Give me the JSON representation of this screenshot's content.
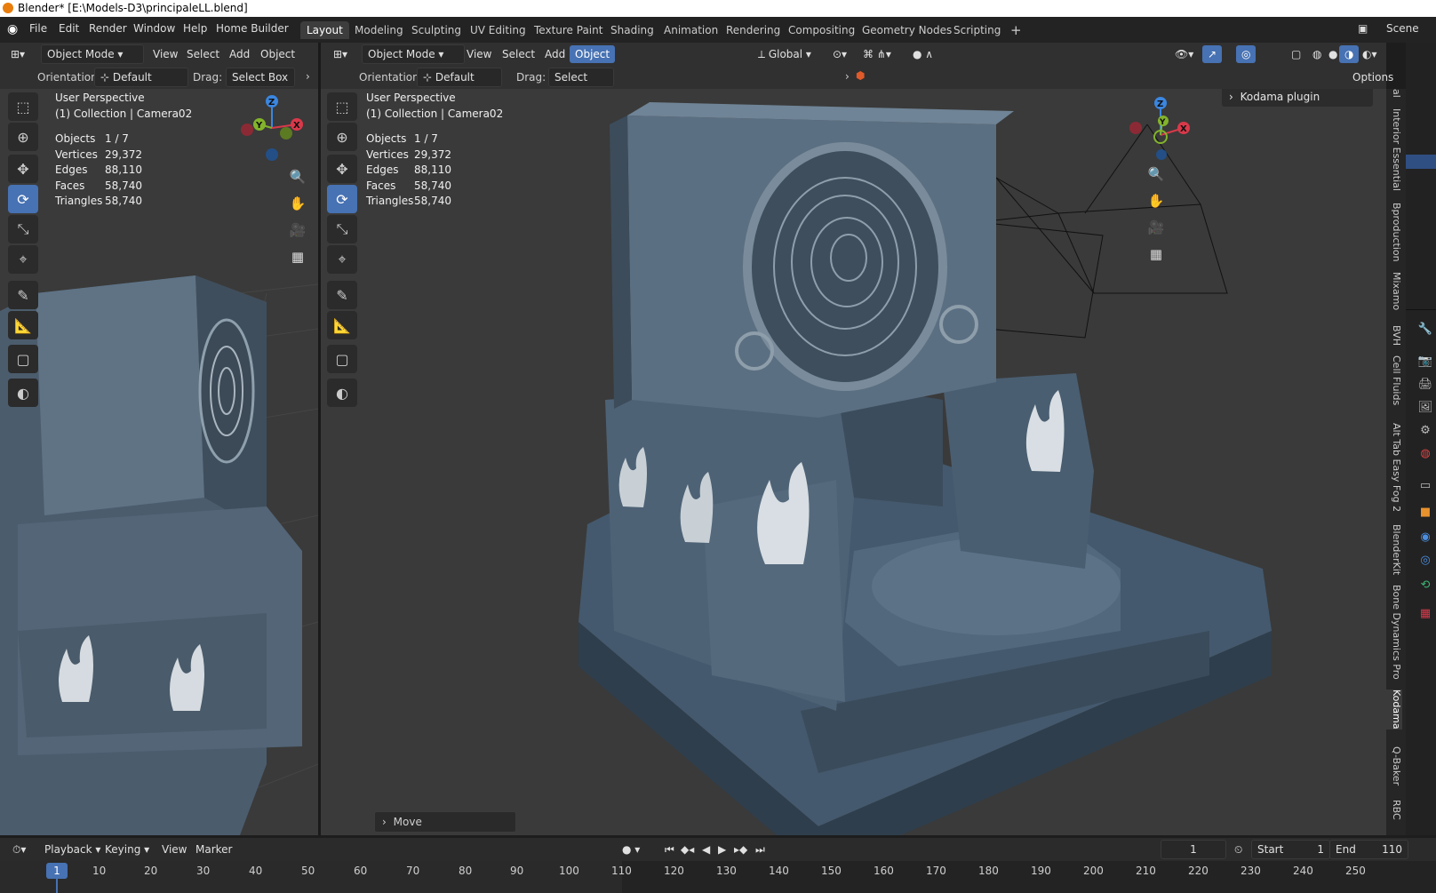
{
  "window": {
    "title": "Blender* [E:\\Models-D3\\principaleLL.blend]"
  },
  "menu": [
    "File",
    "Edit",
    "Render",
    "Window",
    "Help",
    "Home Builder"
  ],
  "workspaces": [
    "Layout",
    "Modeling",
    "Sculpting",
    "UV Editing",
    "Texture Paint",
    "Shading",
    "Animation",
    "Rendering",
    "Compositing",
    "Geometry Nodes",
    "Scripting"
  ],
  "active_workspace": "Layout",
  "scene_label": "Scene",
  "left_view": {
    "header": {
      "mode": "Object Mode",
      "view": "View",
      "select": "Select",
      "add": "Add",
      "object": "Object"
    },
    "tool_header": {
      "orientation_label": "Orientation:",
      "orientation_value": "Default",
      "drag_label": "Drag:",
      "drag_value": "Select Box"
    },
    "info": {
      "perspective": "User Perspective",
      "collection": "(1) Collection | Camera02"
    },
    "stats": [
      {
        "label": "Objects",
        "value": "1 / 7"
      },
      {
        "label": "Vertices",
        "value": "29,372"
      },
      {
        "label": "Edges",
        "value": "88,110"
      },
      {
        "label": "Faces",
        "value": "58,740"
      },
      {
        "label": "Triangles",
        "value": "58,740"
      }
    ]
  },
  "main_view": {
    "header": {
      "mode": "Object Mode",
      "view": "View",
      "select": "Select",
      "add": "Add",
      "object": "Object",
      "transform": "Global",
      "options": "Options"
    },
    "tool_header": {
      "orientation_label": "Orientation:",
      "orientation_value": "Default",
      "drag_label": "Drag:",
      "drag_value": "Select Box"
    },
    "info": {
      "perspective": "User Perspective",
      "collection": "(1) Collection | Camera02"
    },
    "stats": [
      {
        "label": "Objects",
        "value": "1 / 7"
      },
      {
        "label": "Vertices",
        "value": "29,372"
      },
      {
        "label": "Edges",
        "value": "88,110"
      },
      {
        "label": "Faces",
        "value": "58,740"
      },
      {
        "label": "Triangles",
        "value": "58,740"
      }
    ],
    "panel": "Kodama plugin",
    "operator_panel": "Move"
  },
  "gizmo": {
    "x": "X",
    "y": "Y",
    "z": "Z"
  },
  "sidebar_tabs": [
    "al",
    "Interior Essential",
    "Bproduction",
    "Mixamo",
    "BVH",
    "Cell Fluids",
    "Alt Tab Easy Fog 2",
    "BlenderKit",
    "Bone Dynamics Pro",
    "Kodama",
    "Q-Baker",
    "RBC"
  ],
  "timeline": {
    "menus": [
      "Playback",
      "Keying",
      "View",
      "Marker"
    ],
    "current_frame": "1",
    "start_label": "Start",
    "start_value": "1",
    "end_label": "End",
    "end_value": "110",
    "ruler": [
      "1",
      "10",
      "20",
      "30",
      "40",
      "50",
      "60",
      "70",
      "80",
      "90",
      "100",
      "110",
      "120",
      "130",
      "140",
      "150",
      "160",
      "170",
      "180",
      "190",
      "200",
      "210",
      "220",
      "230",
      "240",
      "250"
    ]
  },
  "colors": {
    "accent": "#4772b3",
    "axis_x": "#d9394a",
    "axis_y": "#83b32b",
    "axis_z": "#3b86e0",
    "stone": "#56687a"
  }
}
